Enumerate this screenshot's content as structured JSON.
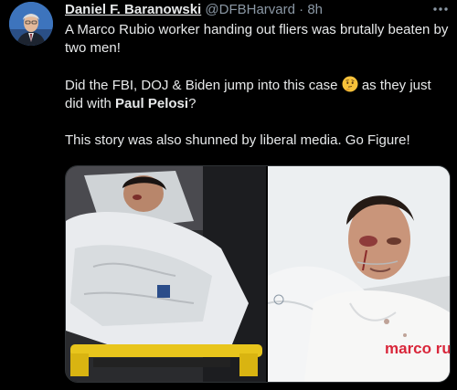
{
  "tweet": {
    "display_name": "Daniel F. Baranowski",
    "handle": "@DFBHarvard",
    "separator": "·",
    "time": "8h",
    "more_icon": "more-dots-icon",
    "line1": "A Marco Rubio worker handing out fliers was brutally beaten by two men!",
    "line2_before": "Did the FBI, DOJ & Biden jump into this case",
    "line2_emoji": "thinking-face-emoji",
    "line2_after": "as they just did with",
    "line2_bold": "Paul Pelosi",
    "line2_end": "?",
    "line3": "This story was also shunned by liberal media. Go Figure!",
    "shirt_text": "marco rub"
  },
  "colors": {
    "background": "#000000",
    "text": "#e7e9ea",
    "secondary": "#8b98a5"
  }
}
